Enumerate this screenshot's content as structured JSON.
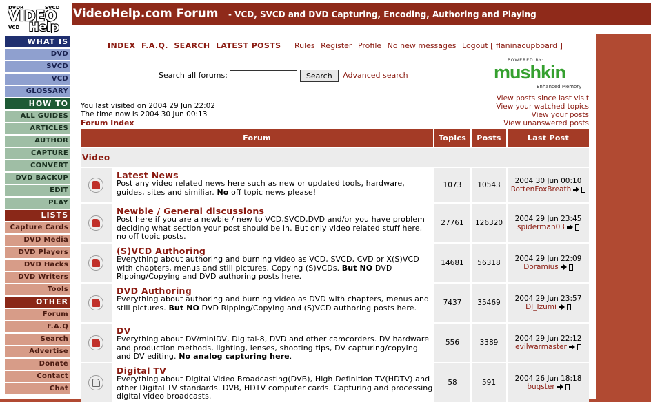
{
  "header": {
    "logo_text": "VIDEO Help",
    "title": "VideoHelp.com Forum",
    "subtitle": "- VCD, SVCD and DVD Capturing, Encoding, Authoring and Playing"
  },
  "sidebar": {
    "what_is": {
      "header": "WHAT IS",
      "items": [
        "DVD",
        "SVCD",
        "VCD",
        "GLOSSARY"
      ]
    },
    "how_to": {
      "header": "HOW TO",
      "items": [
        "ALL GUIDES",
        "ARTICLES",
        "AUTHOR",
        "CAPTURE",
        "CONVERT",
        "DVD BACKUP",
        "EDIT",
        "PLAY"
      ]
    },
    "lists": {
      "header": "LISTS",
      "items": [
        "Capture Cards",
        "DVD Media",
        "DVD Players",
        "DVD Hacks",
        "DVD Writers",
        "Tools"
      ]
    },
    "other": {
      "header": "OTHER",
      "items": [
        "Forum",
        "F.A.Q",
        "Search",
        "Advertise",
        "Donate",
        "Contact",
        "Chat"
      ]
    }
  },
  "nav": {
    "main": [
      "INDEX",
      "F.A.Q.",
      "SEARCH",
      "LATEST POSTS"
    ],
    "secondary": [
      "Rules",
      "Register",
      "Profile",
      "No new messages",
      "Logout [ flaninacupboard ]"
    ]
  },
  "search": {
    "label": "Search all forums:",
    "value": "",
    "button": "Search",
    "advanced": "Advanced search"
  },
  "ad": {
    "powered_by": "POWERED BY:",
    "brand": "mushkin",
    "tagline": "Enhanced Memory"
  },
  "visit": {
    "last_visit": "You last visited on 2004 29 Jun 22:02",
    "time_now": "The time now is 2004 30 Jun 00:13"
  },
  "forum_index_link": "Forum Index",
  "view_links": [
    "View posts since last visit",
    "View your watched topics",
    "View your posts",
    "View unanswered posts"
  ],
  "table": {
    "headers": {
      "forum": "Forum",
      "topics": "Topics",
      "posts": "Posts",
      "last_post": "Last Post"
    },
    "category": "Video",
    "rows": [
      {
        "name": "Latest News",
        "description_html": "Post any video related news here such as new or updated tools, hardware, guides, sites and similiar. <b>No</b> off topic news please!",
        "topics": "1073",
        "posts": "10543",
        "last_date": "2004 30 Jun 00:10",
        "last_user": "RottenFoxBreath",
        "unread": true
      },
      {
        "name": "Newbie / General discussions",
        "description_html": "Post here if you are a newbie / new to VCD,SVCD,DVD and/or you have problem deciding what section your post should be in. But only video related stuff here, no off topic posts.",
        "topics": "27761",
        "posts": "126320",
        "last_date": "2004 29 Jun 23:45",
        "last_user": "spiderman03",
        "unread": true
      },
      {
        "name": "(S)VCD Authoring",
        "description_html": "Everything about authoring and burning video as VCD, SVCD, CVD or X(S)VCD with chapters, menus and still pictures. Copying (S)VCDs. <b>But NO</b> DVD Ripping/Copying and DVD authoring posts here.",
        "topics": "14681",
        "posts": "56318",
        "last_date": "2004 29 Jun 22:09",
        "last_user": "Doramius",
        "unread": true
      },
      {
        "name": "DVD Authoring",
        "description_html": "Everything about authoring and burning video as DVD with chapters, menus and still pictures. <b>But NO</b> DVD Ripping/Copying and (S)VCD authoring posts here.",
        "topics": "7437",
        "posts": "35469",
        "last_date": "2004 29 Jun 23:57",
        "last_user": "DJ_Izumi",
        "unread": true
      },
      {
        "name": "DV",
        "description_html": "Everything about DV/miniDV, Digital-8, DVD and other camcorders. DV hardware and production methods, lighting, lenses, shooting tips, DV capturing/copying and DV editing. <b>No analog capturing here</b>.",
        "topics": "556",
        "posts": "3389",
        "last_date": "2004 29 Jun 22:12",
        "last_user": "evilwarmaster",
        "unread": true
      },
      {
        "name": "Digital TV",
        "description_html": "Everything about Digital Video Broadcasting(DVB), High Definition TV(HDTV) and other Digital TV standards. DVB, HDTV computer cards. Capturing and processing digital video broadcasts.",
        "topics": "58",
        "posts": "591",
        "last_date": "2004 26 Jun 18:18",
        "last_user": "bugster",
        "unread": false
      }
    ]
  }
}
